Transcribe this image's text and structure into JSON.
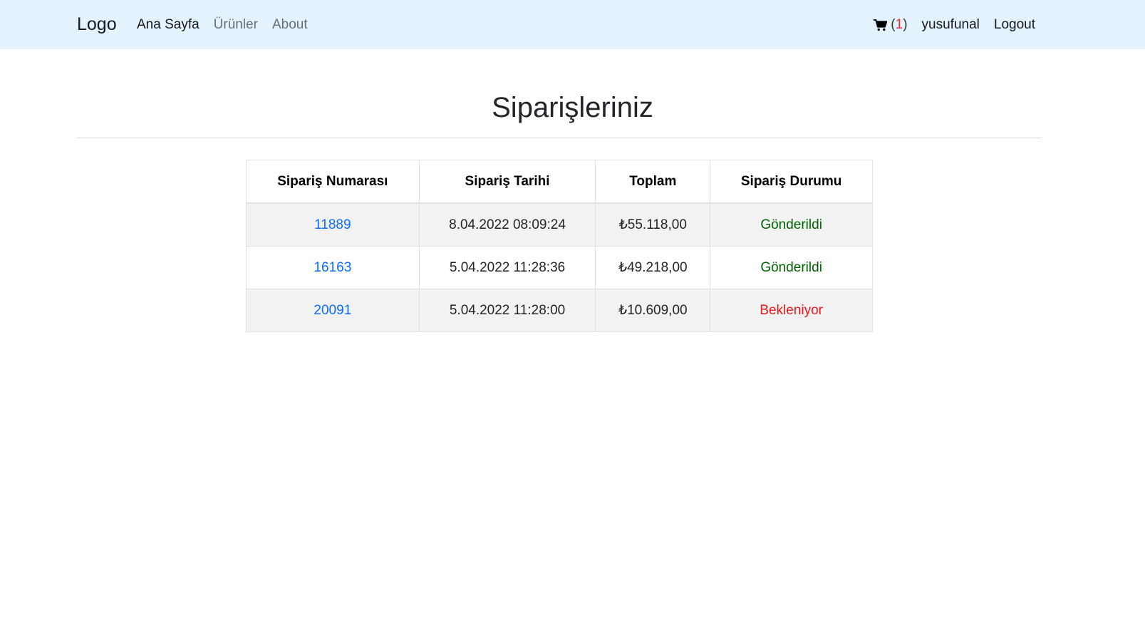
{
  "navbar": {
    "brand": "Logo",
    "links": [
      {
        "label": "Ana Sayfa"
      },
      {
        "label": "Ürünler"
      },
      {
        "label": "About"
      }
    ],
    "cart": {
      "open": "(",
      "count": "1",
      "close": ")"
    },
    "username": "yusufunal",
    "logout": "Logout"
  },
  "page": {
    "title": "Siparişleriniz"
  },
  "orders": {
    "headers": [
      "Sipariş Numarası",
      "Sipariş Tarihi",
      "Toplam",
      "Sipariş Durumu"
    ],
    "rows": [
      {
        "number": "11889",
        "date": "8.04.2022 08:09:24",
        "total": "₺55.118,00",
        "status": "Gönderildi",
        "status_color": "#006400"
      },
      {
        "number": "16163",
        "date": "5.04.2022 11:28:36",
        "total": "₺49.218,00",
        "status": "Gönderildi",
        "status_color": "#006400"
      },
      {
        "number": "20091",
        "date": "5.04.2022 11:28:00",
        "total": "₺10.609,00",
        "status": "Bekleniyor",
        "status_color": "#e81c1c"
      }
    ]
  },
  "colors": {
    "navbar_bg": "#e3f2fd",
    "link": "#0d6efd",
    "status_sent": "#006400",
    "status_wait": "#e81c1c",
    "cart_count": "#dc3545"
  }
}
